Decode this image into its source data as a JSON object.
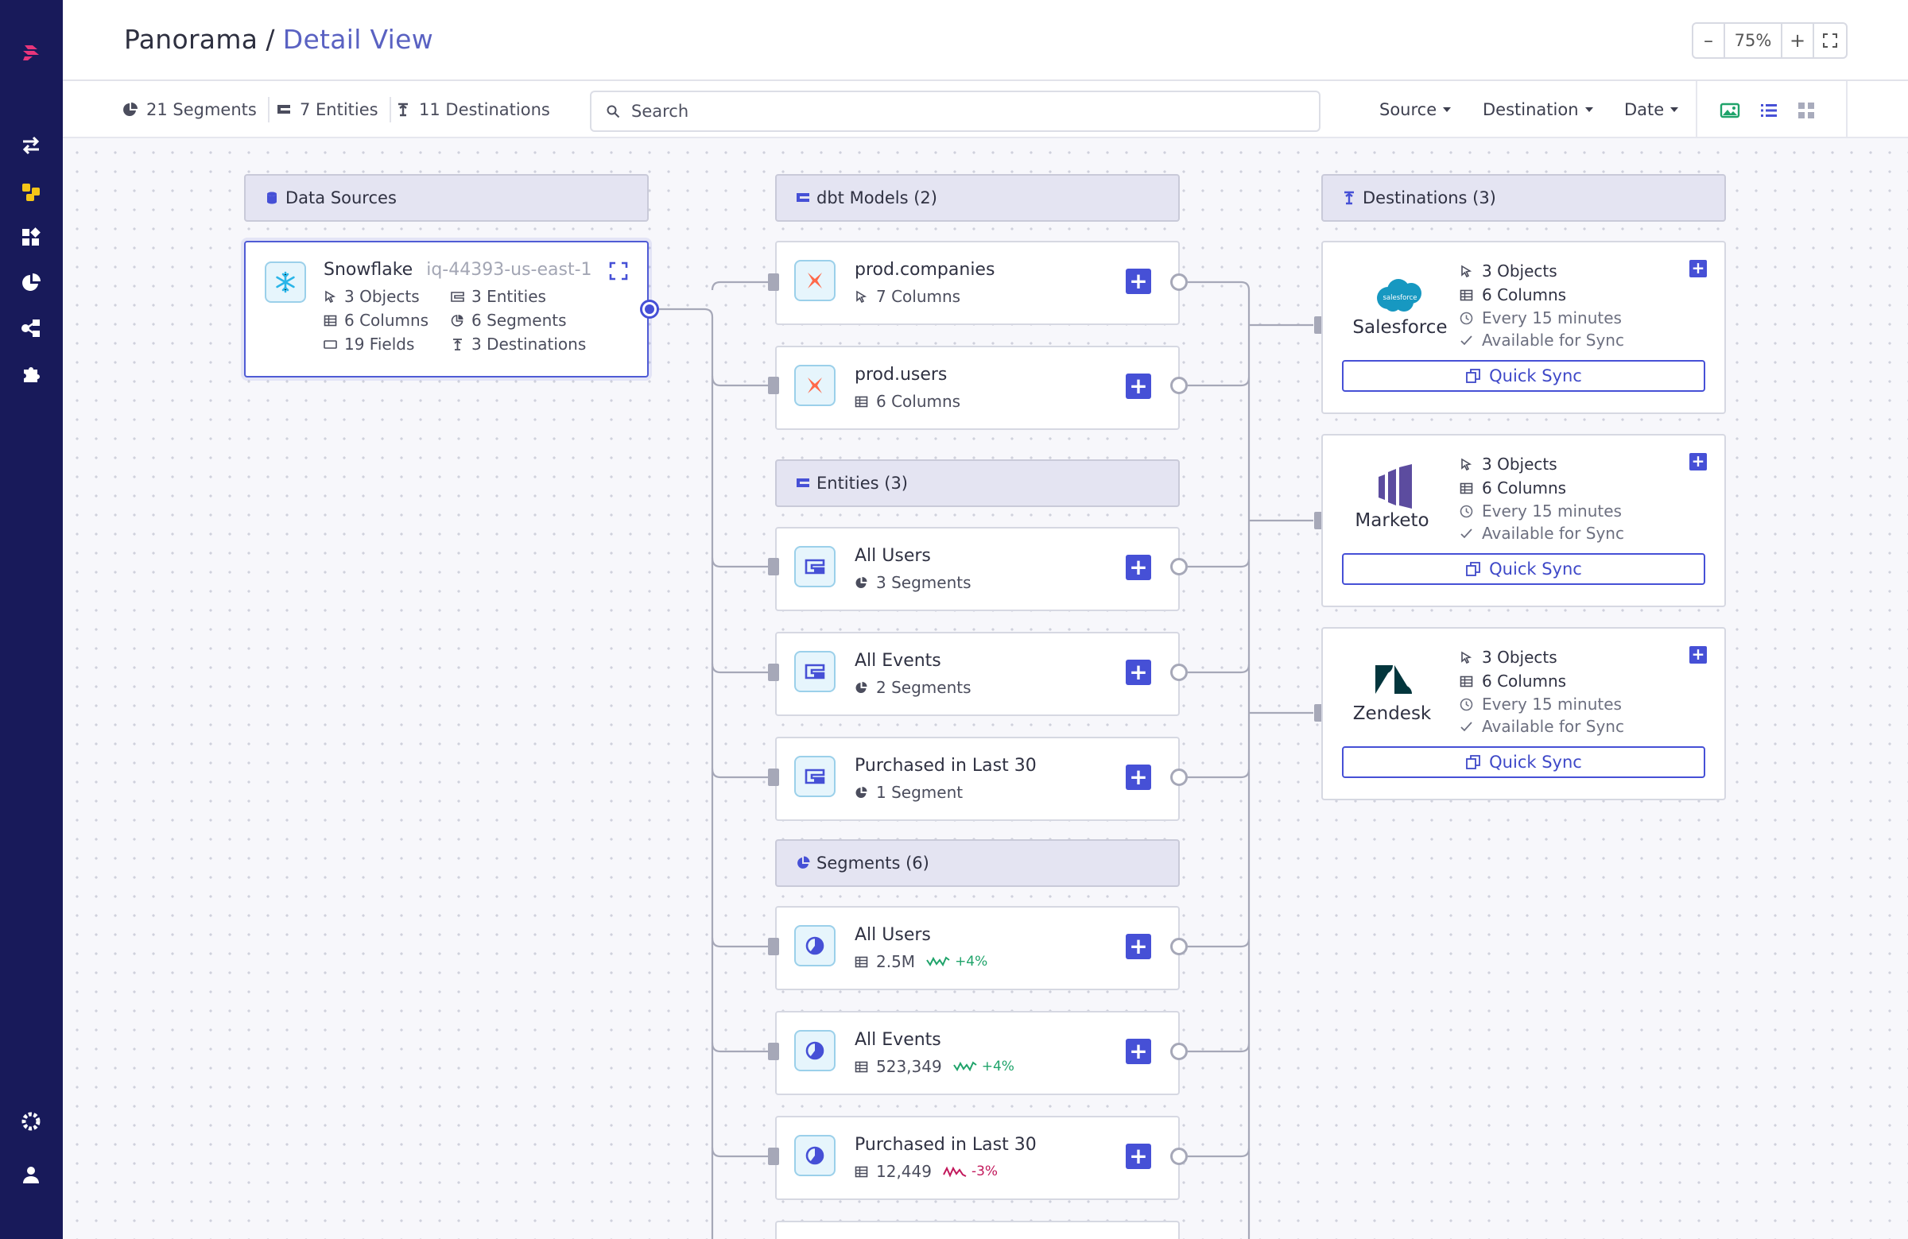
{
  "breadcrumb": {
    "root": "Panorama",
    "separator": "/",
    "current": "Detail View"
  },
  "zoom": {
    "minus": "–",
    "level": "75%",
    "plus": "+"
  },
  "stats": {
    "segments": "21 Segments",
    "entities": "7 Entities",
    "destinations": "11 Destinations"
  },
  "search": {
    "placeholder": "Search"
  },
  "filters": {
    "source": "Source",
    "destination": "Destination",
    "date": "Date"
  },
  "colors": {
    "sidebar": "#181a5a",
    "accent": "#4650d6",
    "positive": "#1fa36a",
    "negative": "#c2185b"
  },
  "sidebar": {
    "icons": [
      "logo-icon",
      "sync-icon",
      "panorama-icon",
      "apps-icon",
      "segments-icon",
      "graph-icon",
      "extensions-icon",
      "settings-icon",
      "user-icon"
    ]
  },
  "data_sources": {
    "header": "Data Sources",
    "card": {
      "title": "Snowflake",
      "subtitle": "iq-44393-us-east-1",
      "objects": "3 Objects",
      "entities": "3 Entities",
      "columns": "6 Columns",
      "segments": "6 Segments",
      "fields": "19 Fields",
      "destinations": "3 Destinations"
    }
  },
  "dbt": {
    "header": "dbt Models (2)",
    "items": [
      {
        "title": "prod.companies",
        "sub": "7 Columns"
      },
      {
        "title": "prod.users",
        "sub": "6 Columns"
      }
    ]
  },
  "entities": {
    "header": "Entities (3)",
    "items": [
      {
        "title": "All Users",
        "sub": "3 Segments"
      },
      {
        "title": "All Events",
        "sub": "2 Segments"
      },
      {
        "title": "Purchased in Last 30",
        "sub": "1 Segment"
      }
    ]
  },
  "segments": {
    "header": "Segments (6)",
    "items": [
      {
        "title": "All Users",
        "count": "2.5M",
        "trend": "+4%",
        "direction": "up"
      },
      {
        "title": "All Events",
        "count": "523,349",
        "trend": "+4%",
        "direction": "up"
      },
      {
        "title": "Purchased in Last 30",
        "count": "12,449",
        "trend": "-3%",
        "direction": "down"
      }
    ]
  },
  "destinations": {
    "header": "Destinations (3)",
    "items": [
      {
        "name": "Salesforce",
        "objects": "3 Objects",
        "columns": "6 Columns",
        "schedule": "Every 15 minutes",
        "status": "Available for Sync",
        "action": "Quick Sync",
        "logo_text": "salesforce"
      },
      {
        "name": "Marketo",
        "objects": "3 Objects",
        "columns": "6 Columns",
        "schedule": "Every 15 minutes",
        "status": "Available for Sync",
        "action": "Quick Sync"
      },
      {
        "name": "Zendesk",
        "objects": "3 Objects",
        "columns": "6 Columns",
        "schedule": "Every 15 minutes",
        "status": "Available for Sync",
        "action": "Quick Sync"
      }
    ]
  }
}
